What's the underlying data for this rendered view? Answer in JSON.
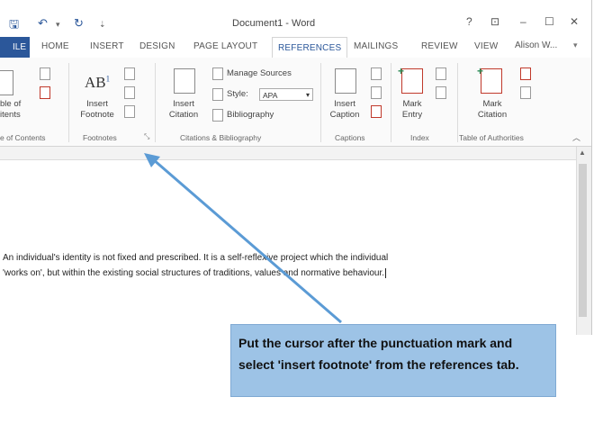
{
  "titlebar": {
    "title": "Document1 - Word",
    "help": "?",
    "restore": "⊡",
    "minimize": "–",
    "maximize": "☐",
    "close": "✕"
  },
  "quick_access": {
    "save_icon": "save-icon",
    "undo_icon": "undo-icon",
    "redo_icon": "redo-icon"
  },
  "tabs": {
    "file": "ILE",
    "items": [
      "HOME",
      "INSERT",
      "DESIGN",
      "PAGE LAYOUT",
      "REFERENCES",
      "MAILINGS",
      "REVIEW",
      "VIEW"
    ],
    "active": "REFERENCES",
    "user": "Alison W..."
  },
  "ribbon": {
    "toc": {
      "label_line1": "ble of",
      "label_line2": "itents"
    },
    "footnotes": {
      "insert_footnote_line1": "Insert",
      "insert_footnote_line2": "Footnote"
    },
    "citations": {
      "insert_citation_line1": "Insert",
      "insert_citation_line2": "Citation",
      "manage_sources": "Manage Sources",
      "style_label": "Style:",
      "style_value": "APA",
      "bibliography": "Bibliography"
    },
    "captions": {
      "insert_caption_line1": "Insert",
      "insert_caption_line2": "Caption"
    },
    "index": {
      "mark_entry_line1": "Mark",
      "mark_entry_line2": "Entry"
    },
    "authorities": {
      "mark_citation_line1": "Mark",
      "mark_citation_line2": "Citation"
    },
    "groups": {
      "toc": "e of Contents",
      "footnotes": "Footnotes",
      "citations": "Citations & Bibliography",
      "captions": "Captions",
      "index": "Index",
      "authorities": "Table of Authorities"
    }
  },
  "document": {
    "line1": "An individual's identity is not fixed and prescribed. It is a self-reflexive project which the individual",
    "line2": "'works on', but within the existing social structures of traditions, values and normative behaviour."
  },
  "callout": {
    "text": "Put the cursor after the punctuation mark and select 'insert footnote' from the references tab."
  },
  "colors": {
    "accent": "#2b579a",
    "callout_bg": "#9dc3e6",
    "arrow": "#5b9bd5"
  }
}
